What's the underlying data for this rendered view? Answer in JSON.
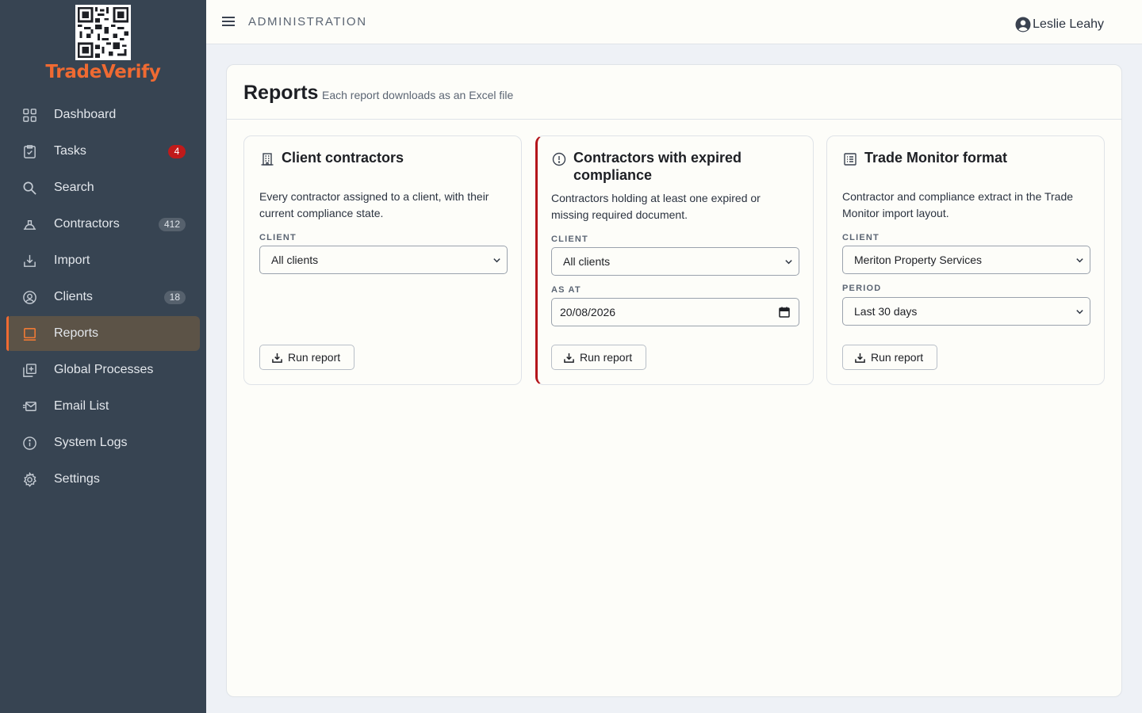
{
  "brand": {
    "name": "TradeVerify",
    "color": "#ef6a32"
  },
  "sidebar": {
    "items": [
      {
        "label": "Dashboard",
        "icon": "grid-icon"
      },
      {
        "label": "Tasks",
        "icon": "clipboard-check-icon",
        "badge": "4"
      },
      {
        "label": "Search",
        "icon": "search-icon"
      },
      {
        "label": "Contractors",
        "icon": "hard-hat-icon",
        "badge": "412"
      },
      {
        "label": "Import",
        "icon": "import-icon"
      },
      {
        "label": "Clients",
        "icon": "user-circle-icon",
        "badge": "18"
      },
      {
        "label": "Reports",
        "icon": "report-icon",
        "active": true
      },
      {
        "label": "Global Processes",
        "icon": "add-stack-icon"
      },
      {
        "label": "Email List",
        "icon": "mail-list-icon"
      },
      {
        "label": "System Logs",
        "icon": "info-icon"
      },
      {
        "label": "Settings",
        "icon": "gear-icon"
      }
    ]
  },
  "topbar": {
    "title": "ADMINISTRATION",
    "user_name": "Leslie Leahy"
  },
  "page": {
    "title": "Reports",
    "subtitle": "Each report downloads as an Excel file"
  },
  "cards": [
    {
      "title": "Client contractors",
      "icon": "building-icon",
      "description": "Every contractor assigned to a client, with their current compliance state.",
      "fields": [
        {
          "label": "CLIENT",
          "value": "All clients"
        }
      ],
      "button": "Run report"
    },
    {
      "title": "Contractors with expired compliance",
      "icon": "alert-circle-icon",
      "accent": "#b4151b",
      "description": "Contractors holding at least one expired or missing required document.",
      "fields": [
        {
          "label": "CLIENT",
          "value": "All clients"
        },
        {
          "label": "AS AT",
          "value": "20/08/2026"
        }
      ],
      "button": "Run report"
    },
    {
      "title": "Trade Monitor format",
      "icon": "table-list-icon",
      "description": "Contractor and compliance extract in the Trade Monitor import layout.",
      "fields": [
        {
          "label": "CLIENT",
          "value": "Meriton Property Services"
        },
        {
          "label": "PERIOD",
          "value": "Last 30 days"
        }
      ],
      "button": "Run report"
    }
  ]
}
